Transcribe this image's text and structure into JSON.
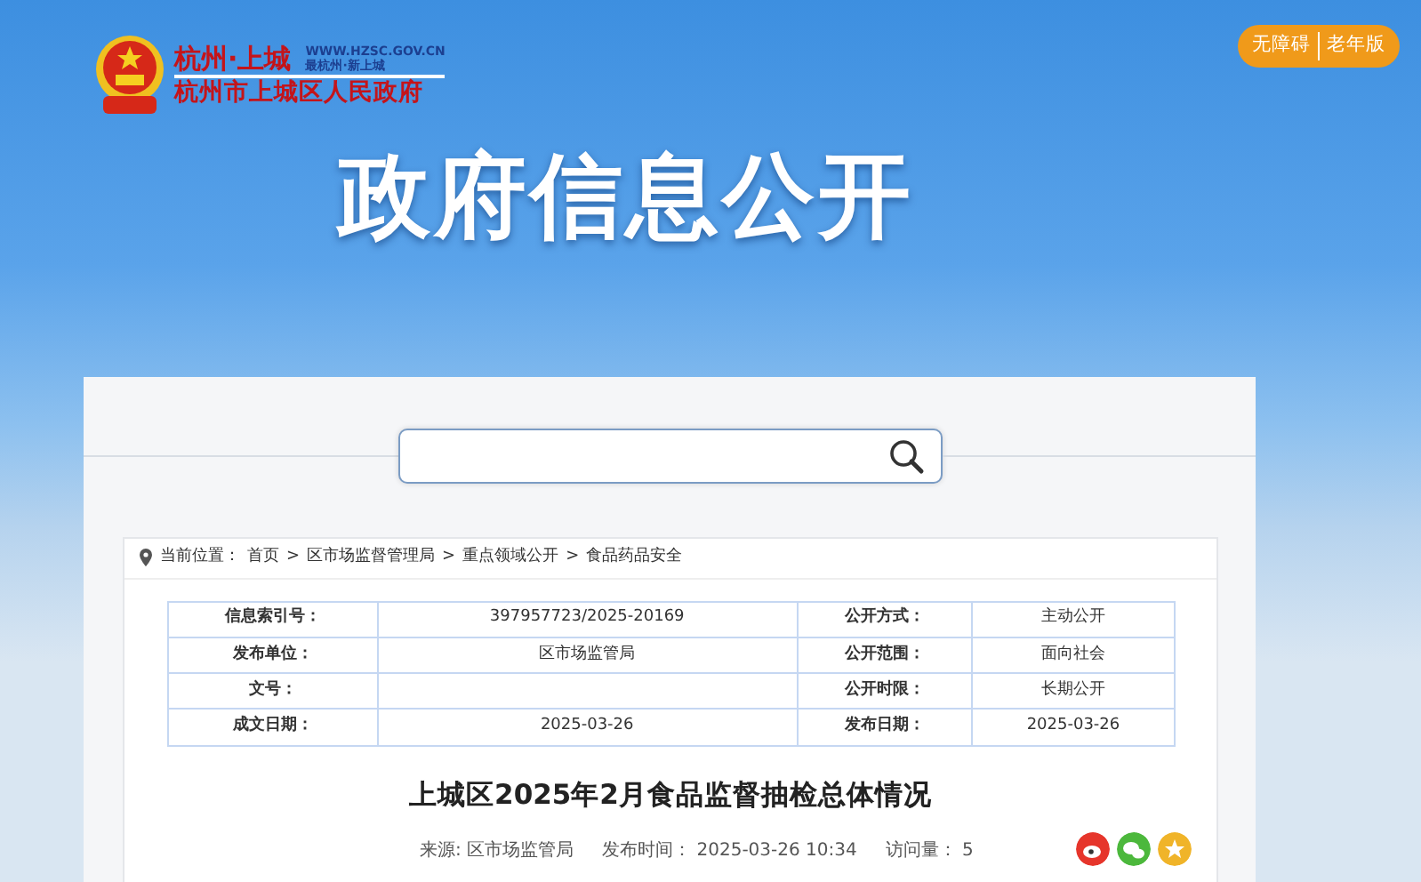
{
  "header": {
    "logo_title": "杭州·上城",
    "logo_url": "WWW.HZSC.GOV.CN",
    "logo_slogan": "最杭州·新上城",
    "logo_subtitle": "杭州市上城区人民政府",
    "banner_title": "政府信息公开",
    "access_buttons": [
      "无障碍",
      "老年版"
    ]
  },
  "breadcrumb": {
    "label": "当前位置：",
    "separator": ">",
    "items": [
      "首页",
      "区市场监督管理局",
      "重点领域公开",
      "食品药品安全"
    ]
  },
  "info_table": {
    "rows": [
      [
        {
          "label": "信息索引号：",
          "value": "397957723/2025-20169"
        },
        {
          "label": "公开方式：",
          "value": "主动公开"
        }
      ],
      [
        {
          "label": "发布单位：",
          "value": "区市场监管局"
        },
        {
          "label": "公开范围：",
          "value": "面向社会"
        }
      ],
      [
        {
          "label": "文号："
        },
        {
          "label": "公开时限：",
          "value": "长期公开"
        }
      ],
      [
        {
          "label": "成文日期：",
          "value": "2025-03-26"
        },
        {
          "label": "发布日期：",
          "value": "2025-03-26"
        }
      ]
    ]
  },
  "article": {
    "title": "上城区2025年2月食品监督抽检总体情况",
    "meta": [
      {
        "label": "来源:",
        "value": "区市场监管局"
      },
      {
        "label": "发布时间：",
        "value": "2025-03-26 10:34"
      },
      {
        "label": "访问量：",
        "value": "5"
      }
    ],
    "share": [
      {
        "kind": "weibo",
        "color": "#e6352b"
      },
      {
        "kind": "wechat",
        "color": "#4cb83c"
      },
      {
        "kind": "favorite",
        "color": "#f0b429"
      }
    ]
  }
}
